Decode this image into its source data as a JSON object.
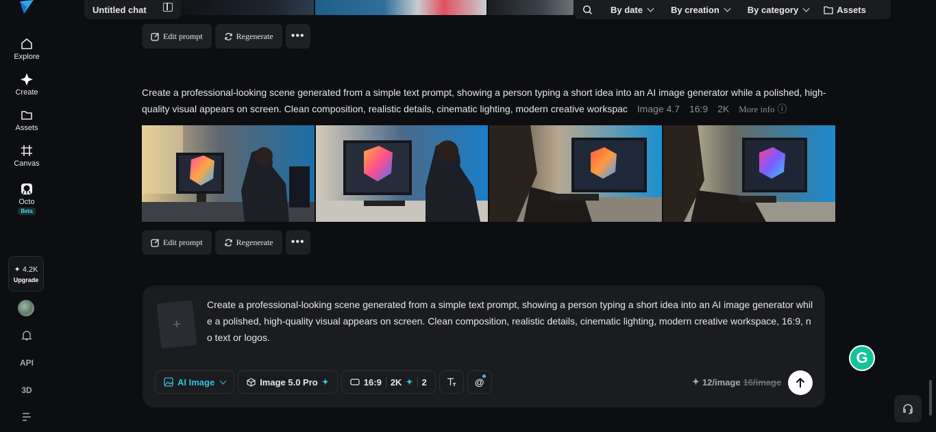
{
  "header": {
    "chat_title": "Untitled chat",
    "filters": [
      "By date",
      "By creation",
      "By category"
    ],
    "assets_label": "Assets"
  },
  "sidebar": {
    "items": [
      {
        "label": "Explore",
        "icon": "home-icon"
      },
      {
        "label": "Create",
        "icon": "sparkle-icon"
      },
      {
        "label": "Assets",
        "icon": "folder-icon"
      },
      {
        "label": "Canvas",
        "icon": "frame-icon"
      },
      {
        "label": "Octo",
        "icon": "octo-icon",
        "badge": "Beta"
      }
    ],
    "credits": "✦ 4.2K",
    "upgrade_label": "Upgrade",
    "api_label": "API",
    "three_d_label": "3D"
  },
  "generation": {
    "prompt": "Create a professional-looking scene generated from a simple text prompt, showing a person typing a short idea into an AI image generator while a polished, high-quality visual appears on screen. Clean composition, realistic details, cinematic lighting, modern creative workspac",
    "model": "Image 4.7",
    "ratio": "16:9",
    "resolution": "2K",
    "more_info": "More info"
  },
  "actions": {
    "edit_prompt": "Edit prompt",
    "regenerate": "Regenerate",
    "more": "•••"
  },
  "composer": {
    "text": "Create a professional-looking scene generated from a simple text prompt, showing a person typing a short idea into an AI image generator while a polished, high-quality visual appears on screen. Clean composition, realistic details, cinematic lighting, modern creative workspace, 16:9, no text or logos.",
    "mode": "AI Image",
    "model": "Image 5.0 Pro",
    "ratio": "16:9",
    "resolution": "2K",
    "count": "2",
    "cost": "12/image",
    "old_cost": "16/image"
  },
  "colors": {
    "background": "#0d0e11",
    "panel": "#1b1c20",
    "accent": "#32c3dd",
    "grammarly": "#15c39a"
  }
}
